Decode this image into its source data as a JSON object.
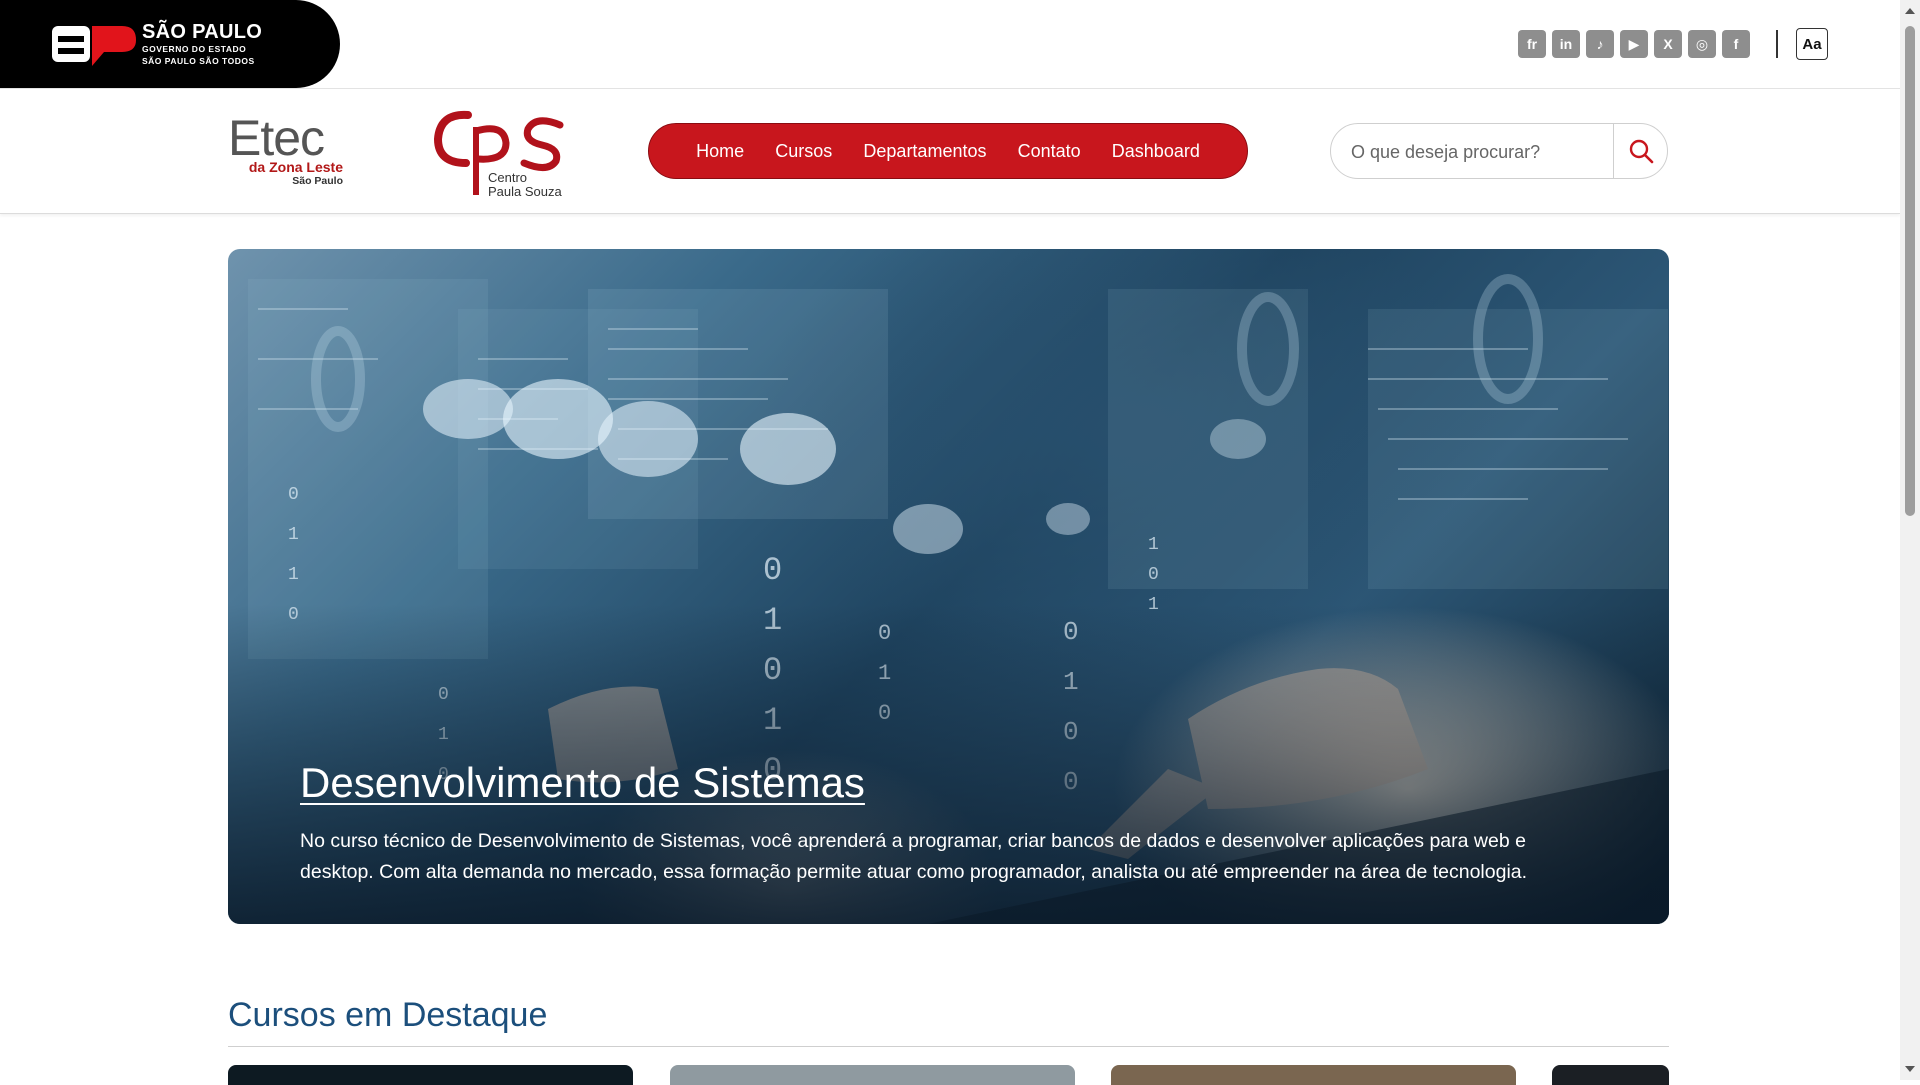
{
  "gov": {
    "title": "SÃO PAULO",
    "subtitle1": "GOVERNO DO ESTADO",
    "subtitle2": "SÃO PAULO SÃO TODOS"
  },
  "socials": [
    {
      "icon": "flickr-icon",
      "label": "fr"
    },
    {
      "icon": "linkedin-icon",
      "label": "in"
    },
    {
      "icon": "tiktok-icon",
      "label": "♪"
    },
    {
      "icon": "youtube-icon",
      "label": "▶"
    },
    {
      "icon": "x-icon",
      "label": "X"
    },
    {
      "icon": "instagram-icon",
      "label": "◎"
    },
    {
      "icon": "facebook-icon",
      "label": "f"
    }
  ],
  "accessibility": {
    "font_toggle": "Aa"
  },
  "brand": {
    "etec_main": "Etec",
    "etec_sub": "da Zona Leste",
    "etec_city": "São Paulo",
    "cps_line1": "Centro",
    "cps_line2": "Paula Souza"
  },
  "nav": {
    "items": [
      "Home",
      "Cursos",
      "Departamentos",
      "Contato",
      "Dashboard"
    ]
  },
  "search": {
    "placeholder": "O que deseja procurar?"
  },
  "hero": {
    "title": "Desenvolvimento de Sistemas",
    "description": "No curso técnico de Desenvolvimento de Sistemas, você aprenderá a programar, criar bancos de dados e desenvolver aplicações para web e desktop. Com alta demanda no mercado, essa formação permite atuar como programador, analista ou até empreender na área de tecnologia."
  },
  "featured": {
    "title": "Cursos em Destaque"
  },
  "colors": {
    "brand_red": "#c8161d",
    "heading_blue": "#1c4f7c",
    "gov_black": "#000000"
  }
}
